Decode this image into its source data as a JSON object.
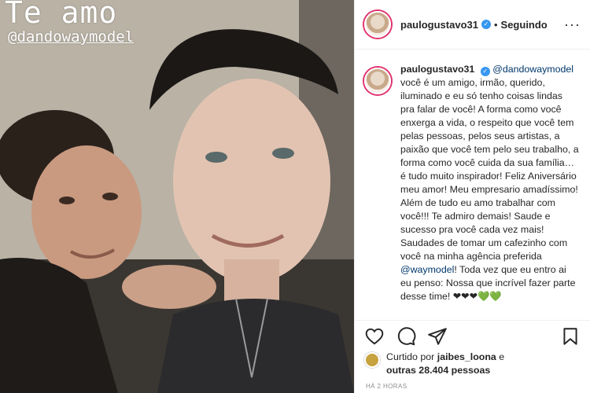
{
  "story": {
    "title": "Te amo",
    "handle": "@dandowaymodel"
  },
  "header": {
    "username": "paulogustavo31",
    "separator": "•",
    "follow_status": "Seguindo",
    "more_icon": "ellipsis-icon"
  },
  "caption": {
    "username": "paulogustavo31",
    "mention_start": "@dandowaymodel",
    "text_part1": "você é um amigo, irmão, querido, iluminado e eu só tenho coisas lindas pra falar de você! A forma como você enxerga a vida, o respeito que você tem pelas pessoas, pelos seus artistas, a paixão que você tem pelo seu trabalho, a forma como você cuida da sua família…é tudo muito inspirador! Feliz Aniversário meu amor! Meu empresario amadíssimo! Além de tudo eu amo trabalhar com você!!! Te admiro demais! Saude e sucesso pra você cada vez mais! Saudades de tomar um cafezinho com você na minha agência preferida",
    "mention_end": "@waymodel",
    "text_part2": "! Toda vez que eu entro ai eu penso: Nossa que incrível fazer parte desse time! ❤❤❤💚💚"
  },
  "actions": {
    "like_icon": "heart-icon",
    "comment_icon": "comment-icon",
    "share_icon": "send-icon",
    "save_icon": "bookmark-icon"
  },
  "likes": {
    "prefix": "Curtido por",
    "user": "jaibes_loona",
    "conj": "e",
    "others": "outras 28.404 pessoas"
  },
  "timestamp": "HÁ 2 HORAS",
  "colors": {
    "link": "#00376b",
    "verified": "#3897f0",
    "muted": "#8e8e8e",
    "story_ring": "#e1306c"
  }
}
